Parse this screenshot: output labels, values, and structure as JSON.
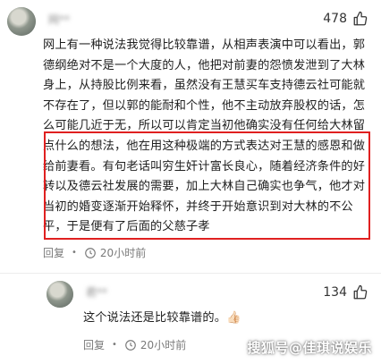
{
  "comments": [
    {
      "username": "网**",
      "like_count": "478",
      "text": "网上有一种说法我觉得比较靠谱，从相声表演中可以看出，郭德纲绝对不是一个大度的人，他把对前妻的怨愤发泄到了大林身上，从持股比例来看，虽然没有王慧买车支持德云社可能就不存在了，但以郭的能耐和个性，他不主动放弃股权的话，怎么可能几近于无，所以可以肯定当初他确实没有任何给大林留点什么的想法，他在用这种极端的方式表达对王慧的感恩和做给前妻看。有句老话叫穷生奸计富长良心，随着经济条件的好转以及德云社发展的需要，加上大林自己确实也争气，他才对当初的婚变逐渐开始释怀，并终于开始意识到对大林的不公平，于是便有了后面的父慈子孝",
      "reply_label": "回复",
      "time": "20小时前"
    },
    {
      "username": "君**",
      "like_count": "134",
      "text": "这个说法还是比较靠谱的。👍🏻",
      "reply_label": "回复",
      "time": "20小时前"
    }
  ],
  "watermark": "搜狐号@佳琪说娱乐",
  "colors": {
    "highlight_border": "#e02020",
    "meta_text": "#7a7a7a"
  },
  "icons": {
    "like": "thumbs-up-icon",
    "time": "clock-icon"
  }
}
